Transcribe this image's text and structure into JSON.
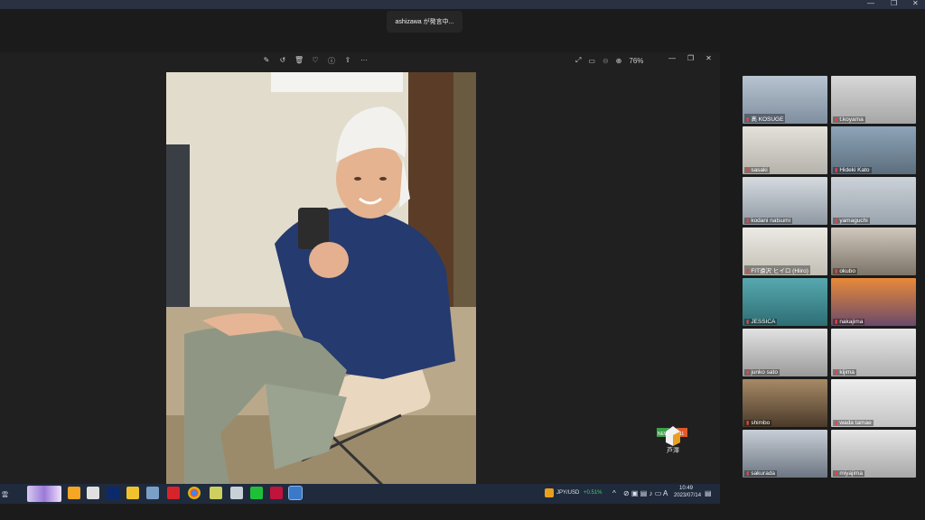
{
  "speaker_toast": "ashizawa が発言中...",
  "viewer": {
    "zoom": "76%",
    "more_label": "···"
  },
  "badge": {
    "label": "芦澤",
    "tag_left": "NEW",
    "tag_right": "11"
  },
  "participants": [
    {
      "name": "髙 KOSUGE"
    },
    {
      "name": "t.koyama"
    },
    {
      "name": "sasaki"
    },
    {
      "name": "Hideki Kato"
    },
    {
      "name": "kodani natsumi"
    },
    {
      "name": "yamaguchi"
    },
    {
      "name": "FIT遠沢 ヒイロ (Hiiro)"
    },
    {
      "name": "okubo"
    },
    {
      "name": "JESSICA"
    },
    {
      "name": "nakajima"
    },
    {
      "name": "junko sato"
    },
    {
      "name": "kijima"
    },
    {
      "name": "shimbo"
    },
    {
      "name": "wada tamae"
    },
    {
      "name": "sakurada"
    },
    {
      "name": "miyajima"
    }
  ],
  "taskbar": {
    "widget_text": "雲",
    "ticker_pair": "JPY/USD",
    "ticker_change": "+0.51%",
    "ime_label": "A",
    "time": "10:49",
    "date": "2023/07/14"
  },
  "colors": {
    "taskbar_bg": "#1f2b3c",
    "viewer_bg": "#202020",
    "ticker_up": "#3fd15e",
    "mic_muted": "#e04848"
  }
}
